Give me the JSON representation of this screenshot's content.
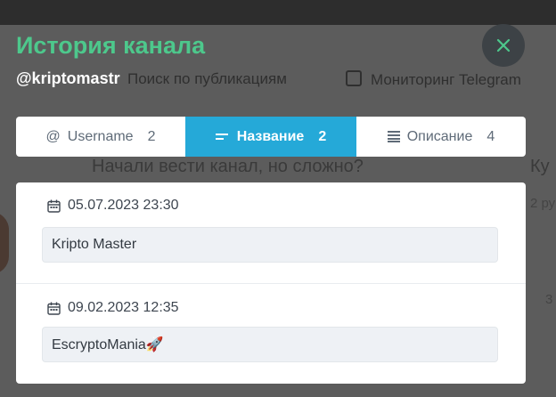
{
  "modal": {
    "title": "История канала",
    "channel": "@kriptomastr",
    "close_icon": "close-icon"
  },
  "background": {
    "nav": [
      "Поиск по публикациям",
      "Мониторинг Telegram"
    ],
    "card_heading": "Начали вести канал, но сложно?",
    "card_heading_right": "Ку",
    "small_right_1": "2 ру",
    "small_right_2": "3"
  },
  "tabs": [
    {
      "label": "Username",
      "count": "2",
      "icon": "at-icon",
      "active": false
    },
    {
      "label": "Название",
      "count": "2",
      "icon": "title-lines-icon",
      "active": true
    },
    {
      "label": "Описание",
      "count": "4",
      "icon": "text-lines-icon",
      "active": false
    }
  ],
  "entries": [
    {
      "date": "05.07.2023 23:30",
      "value": "Kripto Master",
      "icon": "calendar-icon"
    },
    {
      "date": "09.02.2023 12:35",
      "value": "EscryptoMania🚀",
      "icon": "calendar-icon"
    }
  ],
  "colors": {
    "accent_green": "#4dc88c",
    "active_tab": "#25a9d8",
    "overlay": "#575757"
  }
}
